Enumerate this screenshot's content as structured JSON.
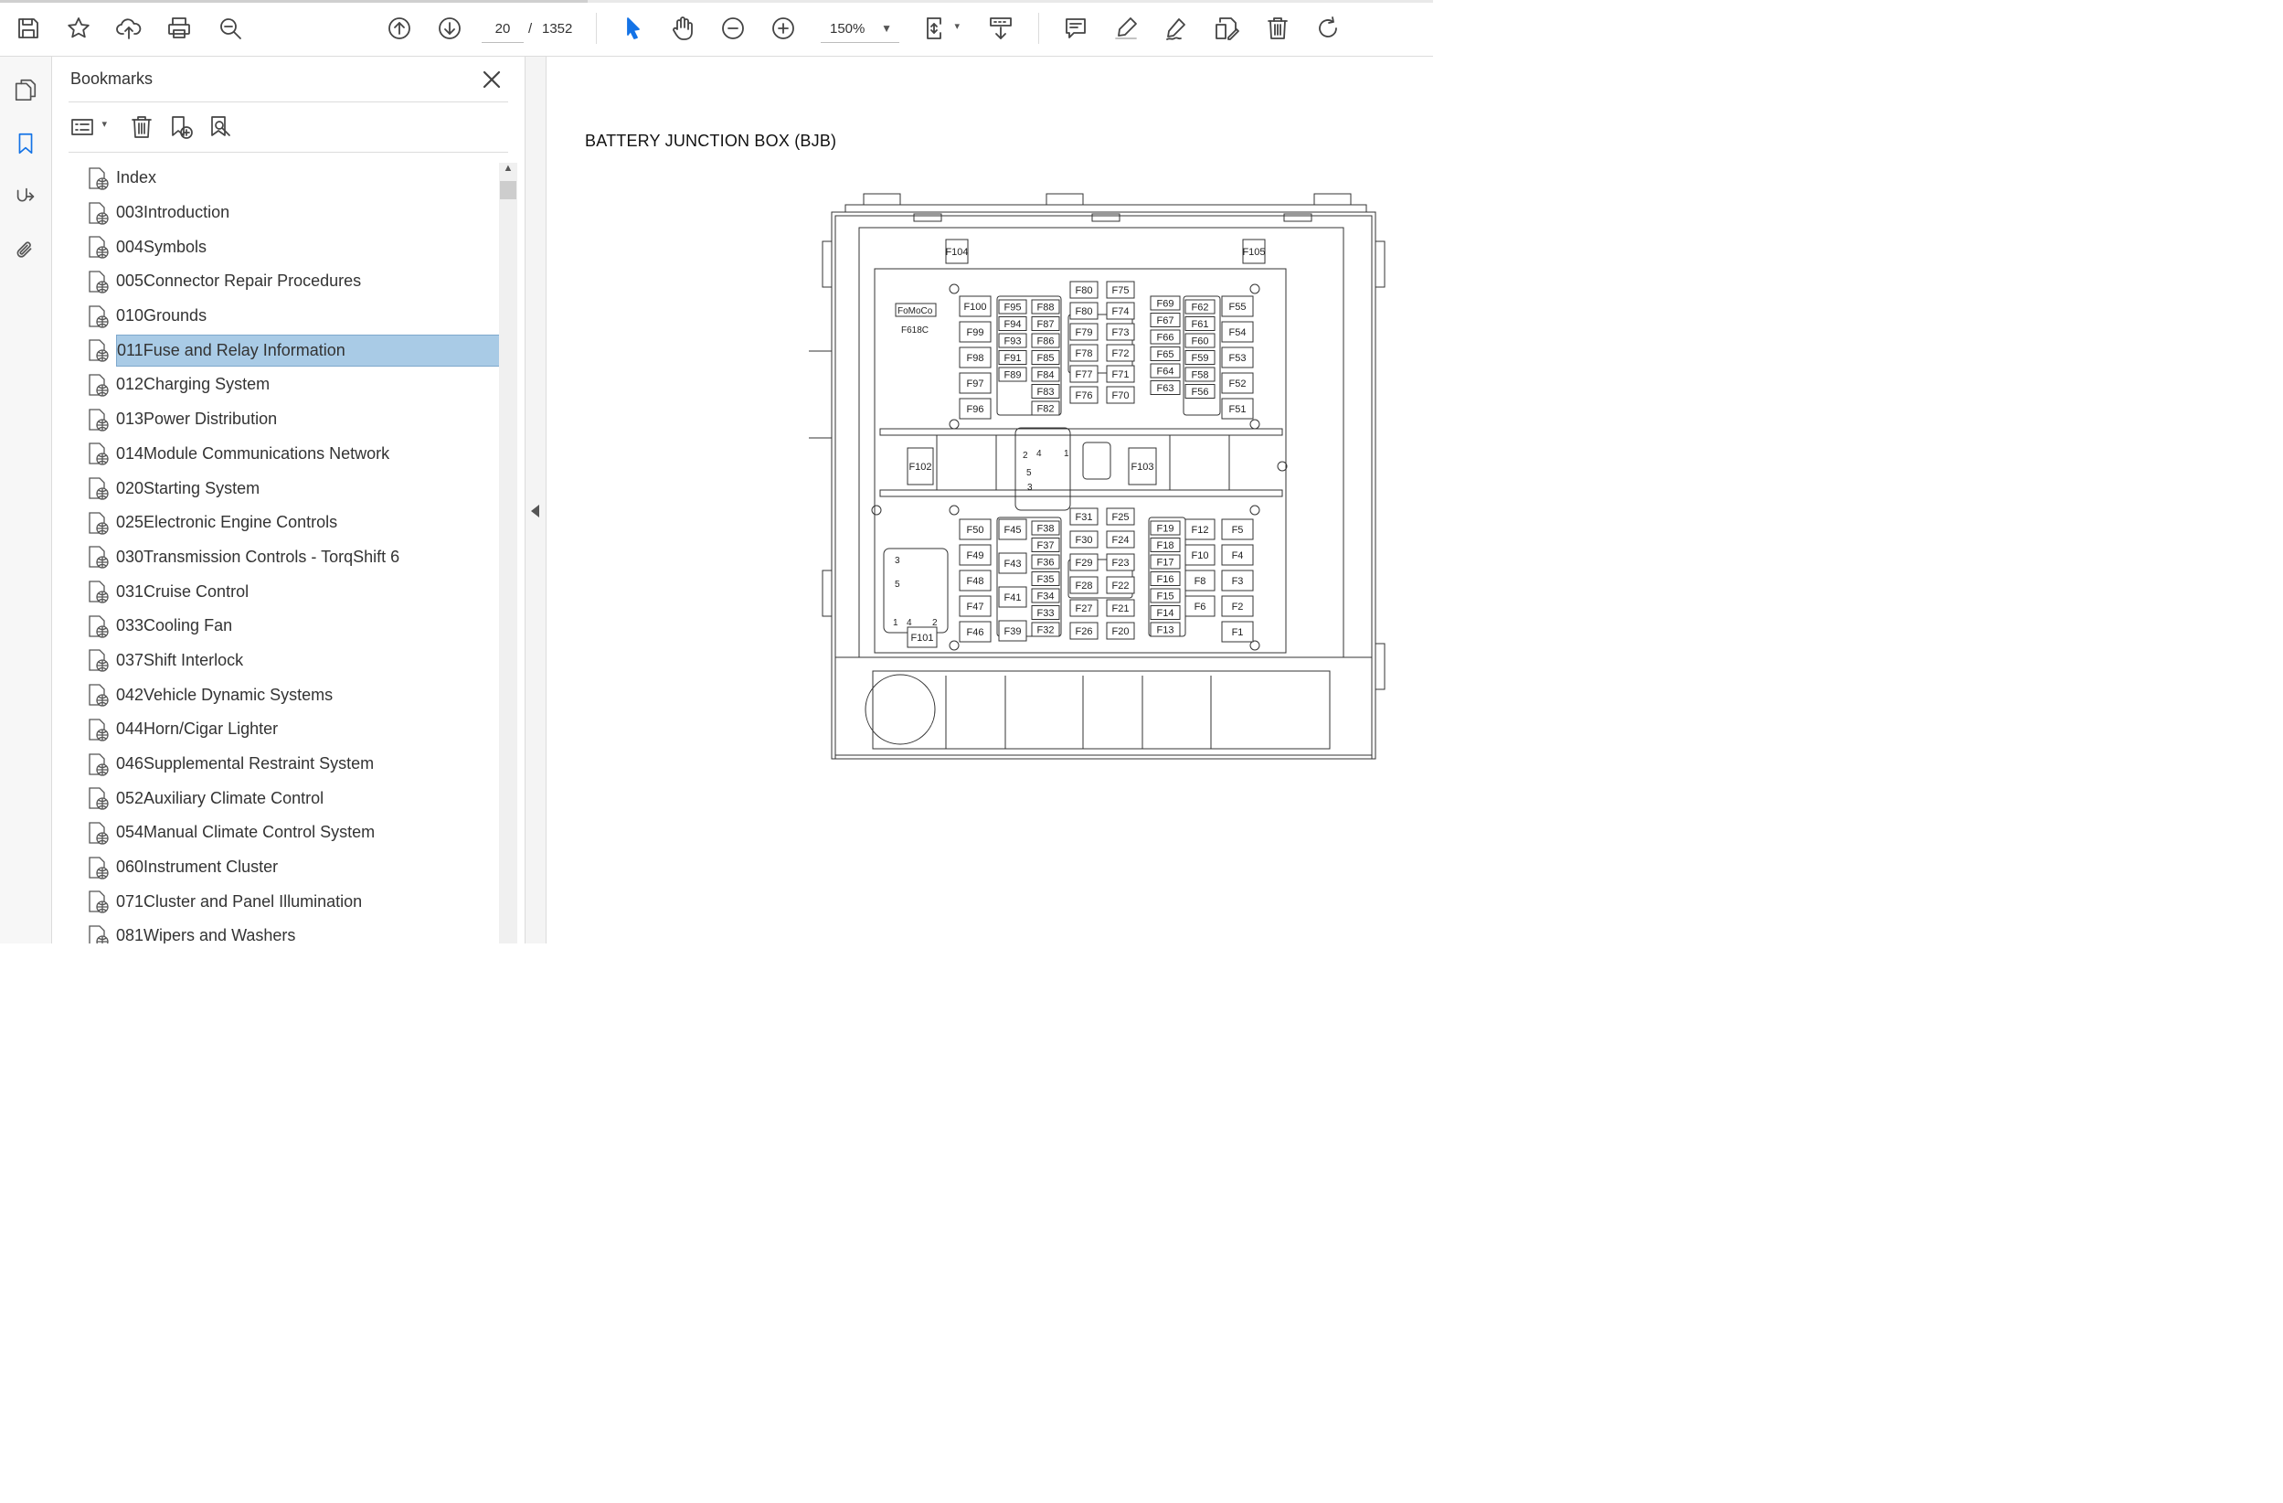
{
  "toolbar": {
    "save": "save-icon",
    "bookmark_star": "star-icon",
    "upload": "cloud-upload-icon",
    "print": "print-icon",
    "find": "search-zoom-icon",
    "prev_page": "arrow-up-circle-icon",
    "next_page": "arrow-down-circle-icon",
    "current_page": "20",
    "page_separator": "/",
    "total_pages": "1352",
    "zoom_level": "150%",
    "load_progress": 0.41
  },
  "rail": {
    "items": [
      "pages-icon",
      "bookmark-icon",
      "signature-icon",
      "attachment-icon"
    ],
    "active": "bookmark-icon"
  },
  "bookmarks_panel": {
    "title": "Bookmarks",
    "items": [
      {
        "label": "Index"
      },
      {
        "label": "003Introduction"
      },
      {
        "label": "004Symbols"
      },
      {
        "label": "005Connector Repair Procedures"
      },
      {
        "label": "010Grounds"
      },
      {
        "label": "011Fuse and Relay Information",
        "selected": true
      },
      {
        "label": "012Charging System"
      },
      {
        "label": "013Power Distribution"
      },
      {
        "label": "014Module Communications Network"
      },
      {
        "label": "020Starting System"
      },
      {
        "label": "025Electronic Engine Controls"
      },
      {
        "label": "030Transmission Controls - TorqShift 6"
      },
      {
        "label": "031Cruise Control"
      },
      {
        "label": "033Cooling Fan"
      },
      {
        "label": "037Shift Interlock"
      },
      {
        "label": "042Vehicle Dynamic Systems"
      },
      {
        "label": "044Horn/Cigar Lighter"
      },
      {
        "label": "046Supplemental Restraint System"
      },
      {
        "label": "052Auxiliary Climate Control"
      },
      {
        "label": "054Manual Climate Control System"
      },
      {
        "label": "060Instrument Cluster"
      },
      {
        "label": "071Cluster and Panel Illumination"
      },
      {
        "label": "081Wipers and Washers"
      }
    ]
  },
  "document": {
    "heading": "BATTERY JUNCTION BOX (BJB)",
    "diagram": {
      "logo": "FoMoCo",
      "part_code": "F618C",
      "side_fuses": [
        "F104",
        "F105",
        "F102",
        "F103",
        "F101"
      ],
      "upper_left_col1": [
        "F100",
        "F99",
        "F98",
        "F97",
        "F96"
      ],
      "upper_left_col2": [
        "F95",
        "F94",
        "F93",
        "F91",
        "F89"
      ],
      "upper_left_col3": [
        "F88",
        "F87",
        "F86",
        "F85",
        "F84",
        "F83",
        "F82"
      ],
      "upper_mid_col1": [
        "F80",
        "F80",
        "F79",
        "F78",
        "F77",
        "F76"
      ],
      "upper_mid_col2": [
        "F75",
        "F74",
        "F73",
        "F72",
        "F71",
        "F70"
      ],
      "upper_right_col1": [
        "F69",
        "F67",
        "F66",
        "F65",
        "F64",
        "F63"
      ],
      "upper_right_col2": [
        "F62",
        "F61",
        "F60",
        "F59",
        "F58",
        "F56"
      ],
      "upper_right_col3": [
        "F55",
        "F54",
        "F53",
        "F52",
        "F51"
      ],
      "lower_left_col1": [
        "F50",
        "F49",
        "F48",
        "F47",
        "F46"
      ],
      "lower_left_col2": [
        "F45",
        "F43",
        "F41",
        "F39"
      ],
      "lower_left_col3": [
        "F38",
        "F37",
        "F36",
        "F35",
        "F34",
        "F33",
        "F32"
      ],
      "lower_mid_col1": [
        "F31",
        "F30",
        "F29",
        "F28",
        "F27",
        "F26"
      ],
      "lower_mid_col2": [
        "F25",
        "F24",
        "F23",
        "F22",
        "F21",
        "F20"
      ],
      "lower_right_col1": [
        "F19",
        "F18",
        "F17",
        "F16",
        "F15",
        "F14",
        "F13"
      ],
      "lower_right_col2": [
        "F12",
        "F10",
        "F8",
        "F6"
      ],
      "lower_right_col3": [
        "F5",
        "F4",
        "F3",
        "F2",
        "F1"
      ],
      "relay_upper_pins": [
        "2",
        "4",
        "1",
        "5",
        "3"
      ],
      "relay_lower_pins": [
        "3",
        "5",
        "1",
        "4",
        "2"
      ]
    }
  }
}
